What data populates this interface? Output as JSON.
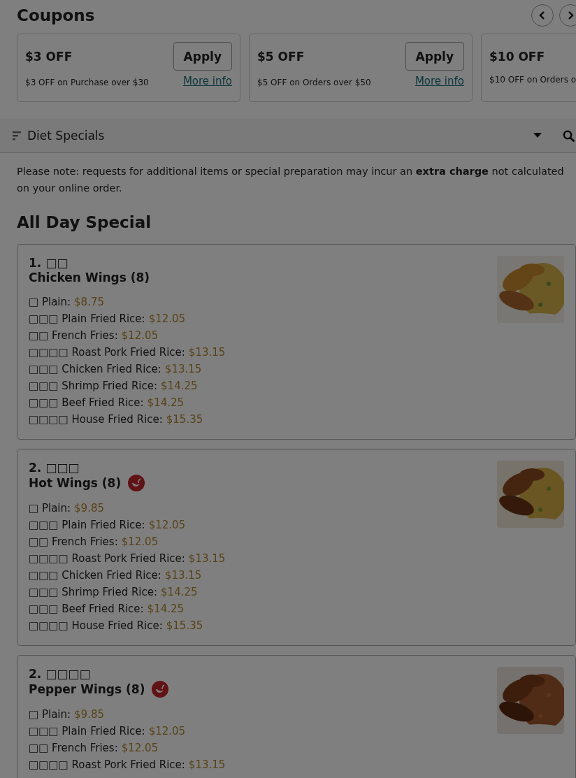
{
  "coupons": {
    "title": "Coupons",
    "items": [
      {
        "title": "$3 OFF",
        "description": "$3 OFF on Purchase over $30",
        "apply": "Apply",
        "more": "More info"
      },
      {
        "title": "$5 OFF",
        "description": "$5 OFF on Orders over $50",
        "apply": "Apply",
        "more": "More info"
      },
      {
        "title": "$10 OFF",
        "description": "$10 OFF on Orders o"
      }
    ]
  },
  "category_bar": {
    "label": "Diet Specials"
  },
  "note": "Please note: requests for additional items or special preparation may incur an **extra charge** not calculated on your online order.",
  "section": {
    "title": "All Day Special",
    "items": [
      {
        "number": "1. □□",
        "name": "Chicken Wings (8)",
        "spicy": false,
        "options": [
          {
            "label": "□ Plain:",
            "price": "$8.75"
          },
          {
            "label": "□□□ Plain Fried Rice:",
            "price": "$12.05"
          },
          {
            "label": "□□ French Fries:",
            "price": "$12.05"
          },
          {
            "label": "□□□□ Roast Pork Fried Rice:",
            "price": "$13.15"
          },
          {
            "label": "□□□ Chicken Fried Rice:",
            "price": "$13.15"
          },
          {
            "label": "□□□ Shrimp Fried Rice:",
            "price": "$14.25"
          },
          {
            "label": "□□□ Beef Fried Rice:",
            "price": "$14.25"
          },
          {
            "label": "□□□□ House Fried Rice:",
            "price": "$15.35"
          }
        ]
      },
      {
        "number": "2. □□□",
        "name": "Hot Wings (8)",
        "spicy": true,
        "options": [
          {
            "label": "□ Plain:",
            "price": "$9.85"
          },
          {
            "label": "□□□ Plain Fried Rice:",
            "price": "$12.05"
          },
          {
            "label": "□□ French Fries:",
            "price": "$12.05"
          },
          {
            "label": "□□□□ Roast Pork Fried Rice:",
            "price": "$13.15"
          },
          {
            "label": "□□□ Chicken Fried Rice:",
            "price": "$13.15"
          },
          {
            "label": "□□□ Shrimp Fried Rice:",
            "price": "$14.25"
          },
          {
            "label": "□□□ Beef Fried Rice:",
            "price": "$14.25"
          },
          {
            "label": "□□□□ House Fried Rice:",
            "price": "$15.35"
          }
        ]
      },
      {
        "number": "2. □□□□",
        "name": "Pepper Wings (8)",
        "spicy": true,
        "options": [
          {
            "label": "□ Plain:",
            "price": "$9.85"
          },
          {
            "label": "□□□ Plain Fried Rice:",
            "price": "$12.05"
          },
          {
            "label": "□□ French Fries:",
            "price": "$12.05"
          },
          {
            "label": "□□□□ Roast Pork Fried Rice:",
            "price": "$13.15"
          }
        ]
      }
    ]
  }
}
